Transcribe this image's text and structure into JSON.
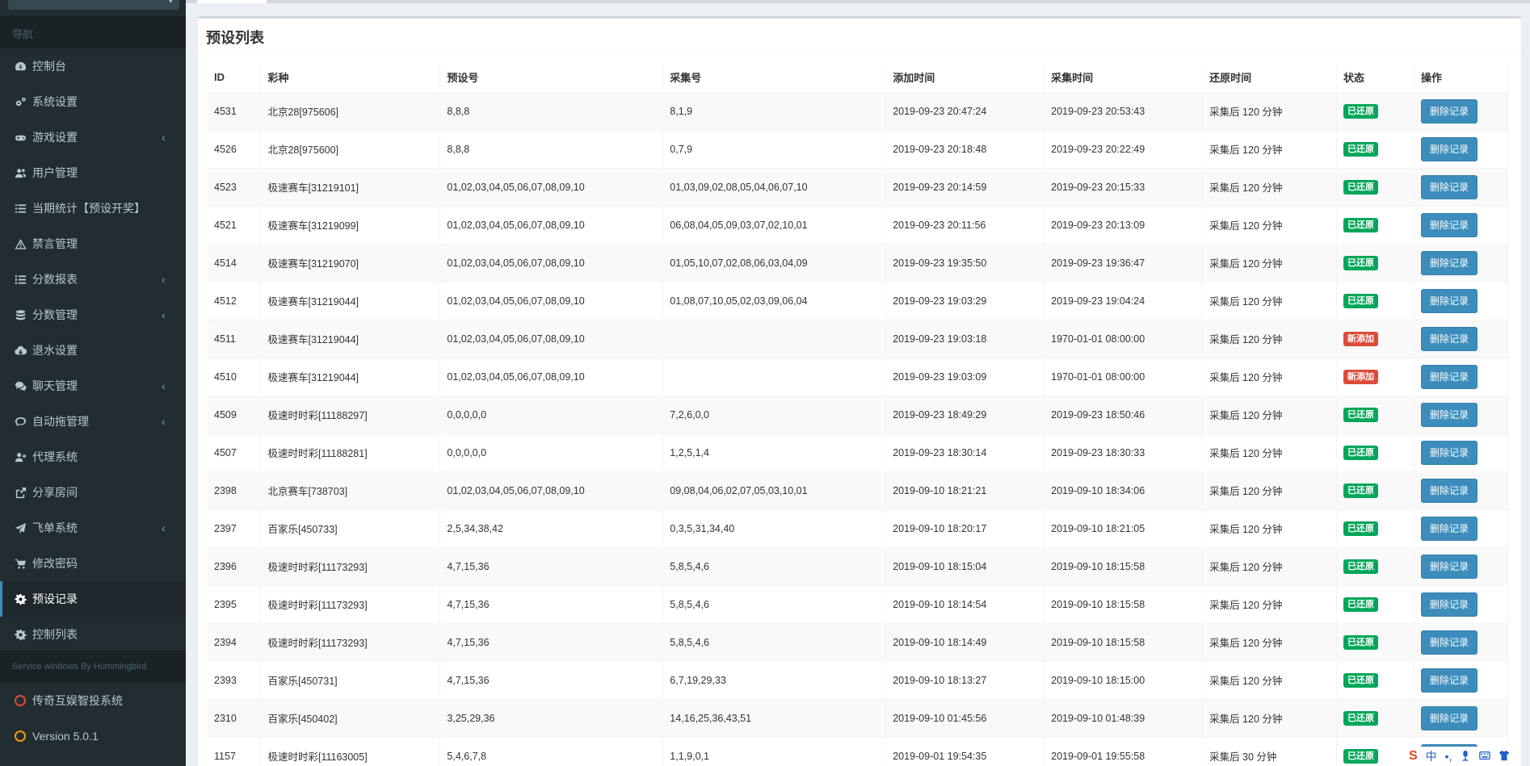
{
  "sidebar": {
    "nav_header": "导航",
    "service_header": "Service windows By Hummingbird",
    "items": [
      {
        "label": "控制台",
        "icon": "dashboard-icon",
        "has_arrow": false,
        "active": false
      },
      {
        "label": "系统设置",
        "icon": "cogs-icon",
        "has_arrow": false,
        "active": false
      },
      {
        "label": "游戏设置",
        "icon": "gamepad-icon",
        "has_arrow": true,
        "active": false
      },
      {
        "label": "用户管理",
        "icon": "users-icon",
        "has_arrow": false,
        "active": false
      },
      {
        "label": "当期统计【预设开奖】",
        "icon": "list-icon",
        "has_arrow": false,
        "active": false
      },
      {
        "label": "禁言管理",
        "icon": "warning-icon",
        "has_arrow": false,
        "active": false
      },
      {
        "label": "分数报表",
        "icon": "list-ol-icon",
        "has_arrow": true,
        "active": false
      },
      {
        "label": "分数管理",
        "icon": "database-icon",
        "has_arrow": true,
        "active": false
      },
      {
        "label": "退水设置",
        "icon": "cloud-download-icon",
        "has_arrow": false,
        "active": false
      },
      {
        "label": "聊天管理",
        "icon": "comments-icon",
        "has_arrow": true,
        "active": false
      },
      {
        "label": "自动拖管理",
        "icon": "comment-icon",
        "has_arrow": true,
        "active": false
      },
      {
        "label": "代理系统",
        "icon": "user-plus-icon",
        "has_arrow": false,
        "active": false
      },
      {
        "label": "分享房间",
        "icon": "share-icon",
        "has_arrow": false,
        "active": false
      },
      {
        "label": "飞单系统",
        "icon": "paper-plane-icon",
        "has_arrow": true,
        "active": false
      },
      {
        "label": "修改密码",
        "icon": "cart-icon",
        "has_arrow": false,
        "active": false
      },
      {
        "label": "预设记录",
        "icon": "gear-icon",
        "has_arrow": false,
        "active": true
      },
      {
        "label": "控制列表",
        "icon": "gear-icon",
        "has_arrow": false,
        "active": false
      }
    ],
    "service_items": [
      {
        "label": "传奇互娱智投系统",
        "icon": "circle-icon",
        "color": "#dd4b39"
      },
      {
        "label": "Version 5.0.1",
        "icon": "circle-icon",
        "color": "#f39c12"
      }
    ]
  },
  "box": {
    "title": "预设列表",
    "columns": [
      "ID",
      "彩种",
      "预设号",
      "采集号",
      "添加时间",
      "采集时间",
      "还原时间",
      "状态",
      "操作"
    ],
    "delete_label": "删除记录",
    "rows": [
      {
        "id": "4531",
        "lottery": "北京28[975606]",
        "preset": "8,8,8",
        "collected": "8,1,9",
        "added": "2019-09-23 20:47:24",
        "collect_time": "2019-09-23 20:53:43",
        "restore": "采集后 120 分钟",
        "status": "已还原",
        "status_color": "green"
      },
      {
        "id": "4526",
        "lottery": "北京28[975600]",
        "preset": "8,8,8",
        "collected": "0,7,9",
        "added": "2019-09-23 20:18:48",
        "collect_time": "2019-09-23 20:22:49",
        "restore": "采集后 120 分钟",
        "status": "已还原",
        "status_color": "green"
      },
      {
        "id": "4523",
        "lottery": "极速赛车[31219101]",
        "preset": "01,02,03,04,05,06,07,08,09,10",
        "collected": "01,03,09,02,08,05,04,06,07,10",
        "added": "2019-09-23 20:14:59",
        "collect_time": "2019-09-23 20:15:33",
        "restore": "采集后 120 分钟",
        "status": "已还原",
        "status_color": "green"
      },
      {
        "id": "4521",
        "lottery": "极速赛车[31219099]",
        "preset": "01,02,03,04,05,06,07,08,09,10",
        "collected": "06,08,04,05,09,03,07,02,10,01",
        "added": "2019-09-23 20:11:56",
        "collect_time": "2019-09-23 20:13:09",
        "restore": "采集后 120 分钟",
        "status": "已还原",
        "status_color": "green"
      },
      {
        "id": "4514",
        "lottery": "极速赛车[31219070]",
        "preset": "01,02,03,04,05,06,07,08,09,10",
        "collected": "01,05,10,07,02,08,06,03,04,09",
        "added": "2019-09-23 19:35:50",
        "collect_time": "2019-09-23 19:36:47",
        "restore": "采集后 120 分钟",
        "status": "已还原",
        "status_color": "green"
      },
      {
        "id": "4512",
        "lottery": "极速赛车[31219044]",
        "preset": "01,02,03,04,05,06,07,08,09,10",
        "collected": "01,08,07,10,05,02,03,09,06,04",
        "added": "2019-09-23 19:03:29",
        "collect_time": "2019-09-23 19:04:24",
        "restore": "采集后 120 分钟",
        "status": "已还原",
        "status_color": "green"
      },
      {
        "id": "4511",
        "lottery": "极速赛车[31219044]",
        "preset": "01,02,03,04,05,06,07,08,09,10",
        "collected": "",
        "added": "2019-09-23 19:03:18",
        "collect_time": "1970-01-01 08:00:00",
        "restore": "采集后 120 分钟",
        "status": "新添加",
        "status_color": "red"
      },
      {
        "id": "4510",
        "lottery": "极速赛车[31219044]",
        "preset": "01,02,03,04,05,06,07,08,09,10",
        "collected": "",
        "added": "2019-09-23 19:03:09",
        "collect_time": "1970-01-01 08:00:00",
        "restore": "采集后 120 分钟",
        "status": "新添加",
        "status_color": "red"
      },
      {
        "id": "4509",
        "lottery": "极速时时彩[11188297]",
        "preset": "0,0,0,0,0",
        "collected": "7,2,6,0,0",
        "added": "2019-09-23 18:49:29",
        "collect_time": "2019-09-23 18:50:46",
        "restore": "采集后 120 分钟",
        "status": "已还原",
        "status_color": "green"
      },
      {
        "id": "4507",
        "lottery": "极速时时彩[11188281]",
        "preset": "0,0,0,0,0",
        "collected": "1,2,5,1,4",
        "added": "2019-09-23 18:30:14",
        "collect_time": "2019-09-23 18:30:33",
        "restore": "采集后 120 分钟",
        "status": "已还原",
        "status_color": "green"
      },
      {
        "id": "2398",
        "lottery": "北京赛车[738703]",
        "preset": "01,02,03,04,05,06,07,08,09,10",
        "collected": "09,08,04,06,02,07,05,03,10,01",
        "added": "2019-09-10 18:21:21",
        "collect_time": "2019-09-10 18:34:06",
        "restore": "采集后 120 分钟",
        "status": "已还原",
        "status_color": "green"
      },
      {
        "id": "2397",
        "lottery": "百家乐[450733]",
        "preset": "2,5,34,38,42",
        "collected": "0,3,5,31,34,40",
        "added": "2019-09-10 18:20:17",
        "collect_time": "2019-09-10 18:21:05",
        "restore": "采集后 120 分钟",
        "status": "已还原",
        "status_color": "green"
      },
      {
        "id": "2396",
        "lottery": "极速时时彩[11173293]",
        "preset": "4,7,15,36",
        "collected": "5,8,5,4,6",
        "added": "2019-09-10 18:15:04",
        "collect_time": "2019-09-10 18:15:58",
        "restore": "采集后 120 分钟",
        "status": "已还原",
        "status_color": "green"
      },
      {
        "id": "2395",
        "lottery": "极速时时彩[11173293]",
        "preset": "4,7,15,36",
        "collected": "5,8,5,4,6",
        "added": "2019-09-10 18:14:54",
        "collect_time": "2019-09-10 18:15:58",
        "restore": "采集后 120 分钟",
        "status": "已还原",
        "status_color": "green"
      },
      {
        "id": "2394",
        "lottery": "极速时时彩[11173293]",
        "preset": "4,7,15,36",
        "collected": "5,8,5,4,6",
        "added": "2019-09-10 18:14:49",
        "collect_time": "2019-09-10 18:15:58",
        "restore": "采集后 120 分钟",
        "status": "已还原",
        "status_color": "green"
      },
      {
        "id": "2393",
        "lottery": "百家乐[450731]",
        "preset": "4,7,15,36",
        "collected": "6,7,19,29,33",
        "added": "2019-09-10 18:13:27",
        "collect_time": "2019-09-10 18:15:00",
        "restore": "采集后 120 分钟",
        "status": "已还原",
        "status_color": "green"
      },
      {
        "id": "2310",
        "lottery": "百家乐[450402]",
        "preset": "3,25,29,36",
        "collected": "14,16,25,36,43,51",
        "added": "2019-09-10 01:45:56",
        "collect_time": "2019-09-10 01:48:39",
        "restore": "采集后 120 分钟",
        "status": "已还原",
        "status_color": "green"
      },
      {
        "id": "1157",
        "lottery": "极速时时彩[11163005]",
        "preset": "5,4,6,7,8",
        "collected": "1,1,9,0,1",
        "added": "2019-09-01 19:54:35",
        "collect_time": "2019-09-01 19:55:58",
        "restore": "采集后 30 分钟",
        "status": "已还原",
        "status_color": "green"
      }
    ]
  },
  "ime": {
    "lang": "中",
    "punct": "•,"
  }
}
